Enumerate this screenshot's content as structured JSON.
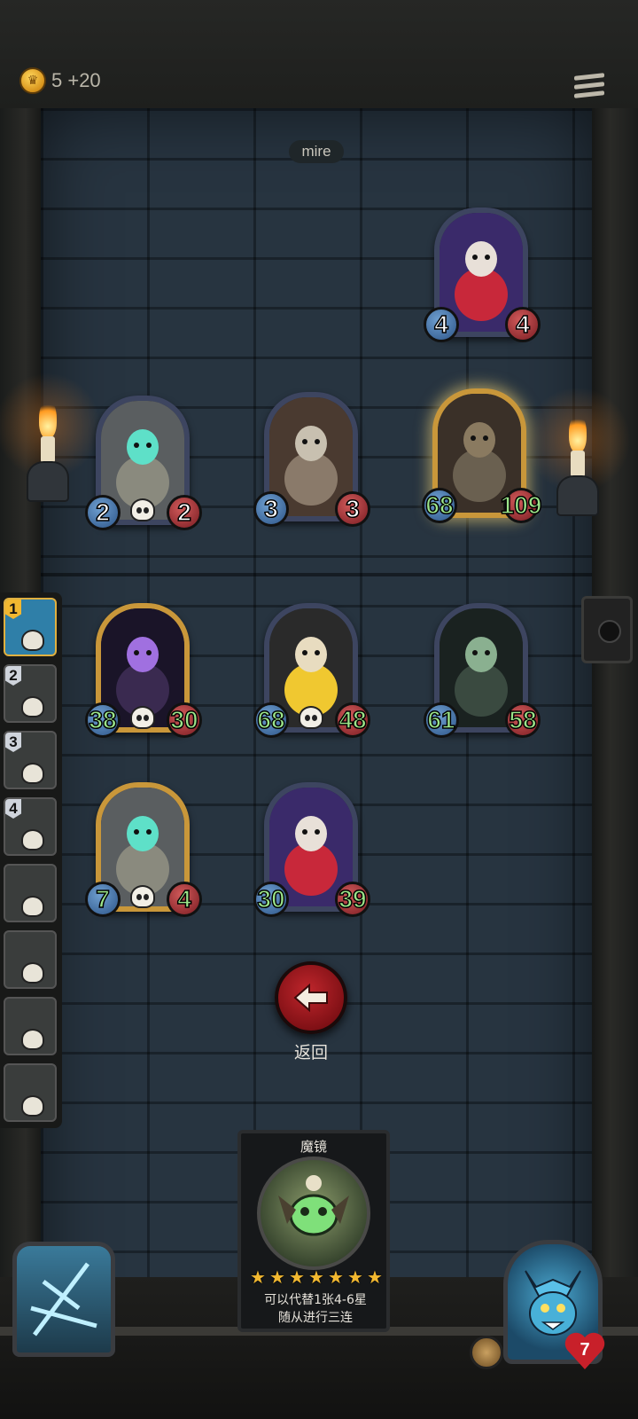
{
  "topbar": {
    "gold_text": "5 +20",
    "coin_icon": "crown-coin-icon",
    "menu_icon": "menu-icon"
  },
  "area_label": "mire",
  "opponent_board": [
    {
      "name": "clown-minion",
      "attack": "4",
      "health": "4",
      "frame": "silver",
      "buffed": false,
      "skull": false
    },
    {
      "name": "bell-robot-minion",
      "attack": "2",
      "health": "2",
      "frame": "silver",
      "buffed": false,
      "skull": true
    },
    {
      "name": "rocket-minion",
      "attack": "3",
      "health": "3",
      "frame": "silver",
      "buffed": false,
      "skull": false
    },
    {
      "name": "ogre-minion",
      "attack": "68",
      "health": "109",
      "frame": "gold",
      "buffed": true,
      "skull": false
    }
  ],
  "player_board": [
    {
      "name": "hooded-mage-minion",
      "attack": "38",
      "health": "30",
      "frame": "gold",
      "buffed": true,
      "skull": true
    },
    {
      "name": "grinning-rogue-minion",
      "attack": "68",
      "health": "48",
      "frame": "silver",
      "buffed": true,
      "skull": true
    },
    {
      "name": "skeletal-wraith-minion",
      "attack": "61",
      "health": "58",
      "frame": "silver",
      "buffed": true,
      "skull": false
    },
    {
      "name": "bell-robot-minion",
      "attack": "7",
      "health": "4",
      "frame": "gold",
      "buffed": true,
      "skull": true
    },
    {
      "name": "clown-minion",
      "attack": "30",
      "health": "39",
      "frame": "silver",
      "buffed": true,
      "skull": false
    }
  ],
  "history": [
    {
      "rank": "1",
      "active": true
    },
    {
      "rank": "2",
      "active": false
    },
    {
      "rank": "3",
      "active": false
    },
    {
      "rank": "4",
      "active": false
    },
    {
      "rank": "",
      "active": false
    },
    {
      "rank": "",
      "active": false
    },
    {
      "rank": "",
      "active": false
    },
    {
      "rank": "",
      "active": false
    }
  ],
  "back_button": {
    "label": "返回",
    "icon": "arrow-left-icon"
  },
  "spell_card": {
    "title": "魔镜",
    "stars": 7,
    "description_line1": "可以代替1张4-6星",
    "description_line2": "随从进行三连"
  },
  "hero": {
    "health": "7",
    "power_icon": "lightning-icon",
    "tier_icon": "tavern-tier-icon"
  },
  "colors": {
    "accent_gold": "#c9973a",
    "attack_blue": "#2d5588",
    "health_red": "#7a1c22",
    "buffed_green": "#9ce68a",
    "back_red": "#c0262c"
  }
}
